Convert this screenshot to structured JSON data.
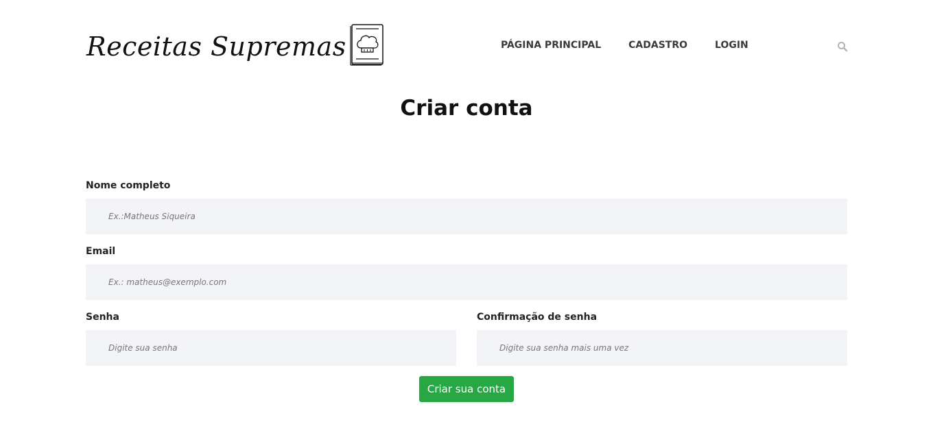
{
  "header": {
    "logo_text": "Receitas Supremas",
    "logo_icon": "chef-hat-book-icon",
    "nav": [
      {
        "label": "PÁGINA PRINCIPAL"
      },
      {
        "label": "CADASTRO"
      },
      {
        "label": "LOGIN"
      }
    ],
    "search_icon": "search-icon"
  },
  "main": {
    "title": "Criar conta",
    "form": {
      "name": {
        "label": "Nome completo",
        "placeholder": "Ex.:Matheus Siqueira",
        "value": ""
      },
      "email": {
        "label": "Email",
        "placeholder": "Ex.: matheus@exemplo.com",
        "value": ""
      },
      "password": {
        "label": "Senha",
        "placeholder": "Digite sua senha",
        "value": ""
      },
      "password_confirm": {
        "label": "Confirmação de senha",
        "placeholder": "Digite sua senha mais uma vez",
        "value": ""
      },
      "submit_label": "Criar sua conta"
    }
  },
  "colors": {
    "submit_bg": "#28a745",
    "field_bg": "#f3f4f7",
    "nav_text": "#3a3a3a"
  }
}
